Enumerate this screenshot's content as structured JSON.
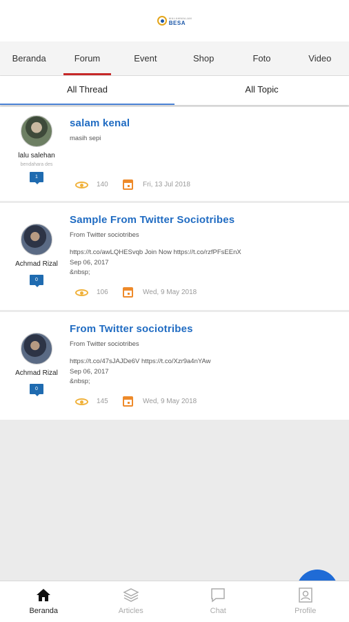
{
  "header": {
    "logo_small": "MALAMMALAM",
    "logo_big": "BESA"
  },
  "navtabs": [
    {
      "label": "Beranda"
    },
    {
      "label": "Forum"
    },
    {
      "label": "Event"
    },
    {
      "label": "Shop"
    },
    {
      "label": "Foto"
    },
    {
      "label": "Video"
    }
  ],
  "active_navtab": "Forum",
  "subtabs": [
    {
      "label": "All Thread"
    },
    {
      "label": "All Topic"
    }
  ],
  "threads": [
    {
      "author": "lalu salehan",
      "role": "bendahara des",
      "replies": "1",
      "title": "salam kenal",
      "desc": "masih sepi",
      "body": "",
      "views": "140",
      "date": "Fri, 13 Jul 2018"
    },
    {
      "author": "Achmad Rizal",
      "role": "",
      "replies": "0",
      "title": "Sample From Twitter Sociotribes",
      "desc": "From Twitter sociotribes",
      "body": "https://t.co/awLQHESvqb Join Now https://t.co/rzfPFsEEnX\nSep 06, 2017\n&nbsp;",
      "views": "106",
      "date": "Wed, 9 May 2018"
    },
    {
      "author": "Achmad Rizal",
      "role": "",
      "replies": "0",
      "title": "From Twitter sociotribes",
      "desc": "From Twitter sociotribes",
      "body": "https://t.co/47sJAJDe6V https://t.co/Xzr9a4nYAw\nSep 06, 2017\n&nbsp;",
      "views": "145",
      "date": "Wed, 9 May 2018"
    }
  ],
  "bottomnav": [
    {
      "label": "Beranda",
      "icon": "home-icon"
    },
    {
      "label": "Articles",
      "icon": "layers-icon"
    },
    {
      "label": "Chat",
      "icon": "chat-icon"
    },
    {
      "label": "Profile",
      "icon": "profile-icon"
    }
  ],
  "colors": {
    "accent": "#1f6bc2",
    "tab_indicator": "#c62828",
    "subtab_indicator": "#4a82d6",
    "badge": "#1f6bb0",
    "fab": "#1f6bd6"
  }
}
